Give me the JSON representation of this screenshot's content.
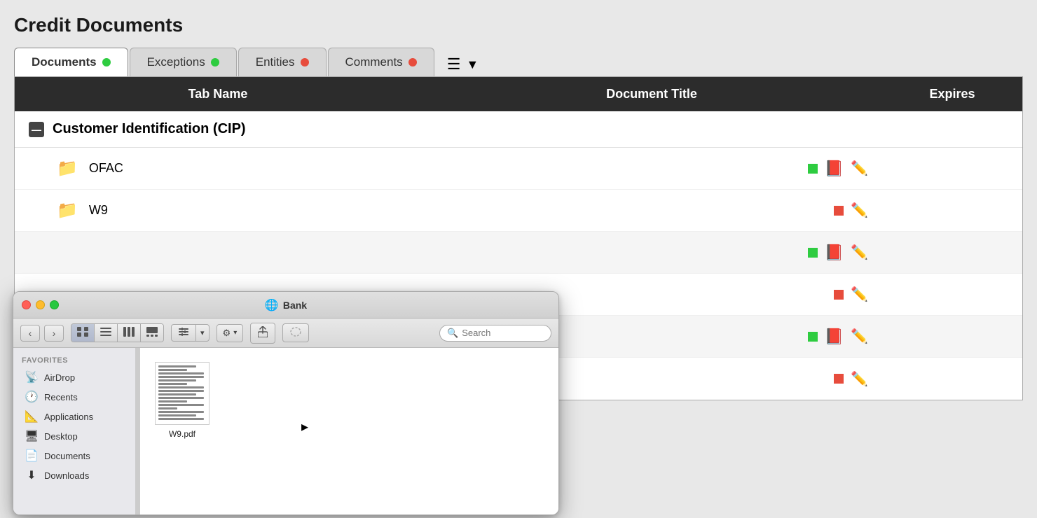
{
  "page": {
    "title": "Credit Documents"
  },
  "tabs": [
    {
      "id": "documents",
      "label": "Documents",
      "dot": "green",
      "active": true
    },
    {
      "id": "exceptions",
      "label": "Exceptions",
      "dot": "green",
      "active": false
    },
    {
      "id": "entities",
      "label": "Entities",
      "dot": "red",
      "active": false
    },
    {
      "id": "comments",
      "label": "Comments",
      "dot": "red",
      "active": false
    }
  ],
  "table": {
    "headers": [
      "Tab Name",
      "Document Title",
      "Expires"
    ],
    "section": "Customer Identification (CIP)",
    "rows": [
      {
        "name": "OFAC",
        "status": "green",
        "has_pdf": true,
        "has_pencil": true
      },
      {
        "name": "W9",
        "status": "red",
        "has_pdf": false,
        "has_pencil": true
      }
    ],
    "extra_rows": [
      {
        "status": "green",
        "has_pdf": true,
        "has_pencil": true
      },
      {
        "status": "red",
        "has_pdf": false,
        "has_pencil": true
      },
      {
        "status": "green",
        "has_pdf": true,
        "has_pencil": true
      },
      {
        "status": "red",
        "has_pdf": false,
        "has_pencil": true
      }
    ]
  },
  "finder": {
    "title": "Bank",
    "title_icon": "🌐",
    "search_placeholder": "Search",
    "nav": {
      "back": "‹",
      "forward": "›"
    },
    "view_buttons": [
      "⊞",
      "☰",
      "⊟",
      "⊡"
    ],
    "action_button_label": "⚙",
    "sidebar": {
      "section_label": "Favorites",
      "items": [
        {
          "icon": "📡",
          "label": "AirDrop"
        },
        {
          "icon": "🕐",
          "label": "Recents"
        },
        {
          "icon": "📐",
          "label": "Applications"
        },
        {
          "icon": "🖥",
          "label": "Desktop"
        },
        {
          "icon": "📄",
          "label": "Documents"
        },
        {
          "icon": "⬇",
          "label": "Downloads"
        }
      ]
    },
    "file": {
      "name": "W9.pdf"
    }
  }
}
